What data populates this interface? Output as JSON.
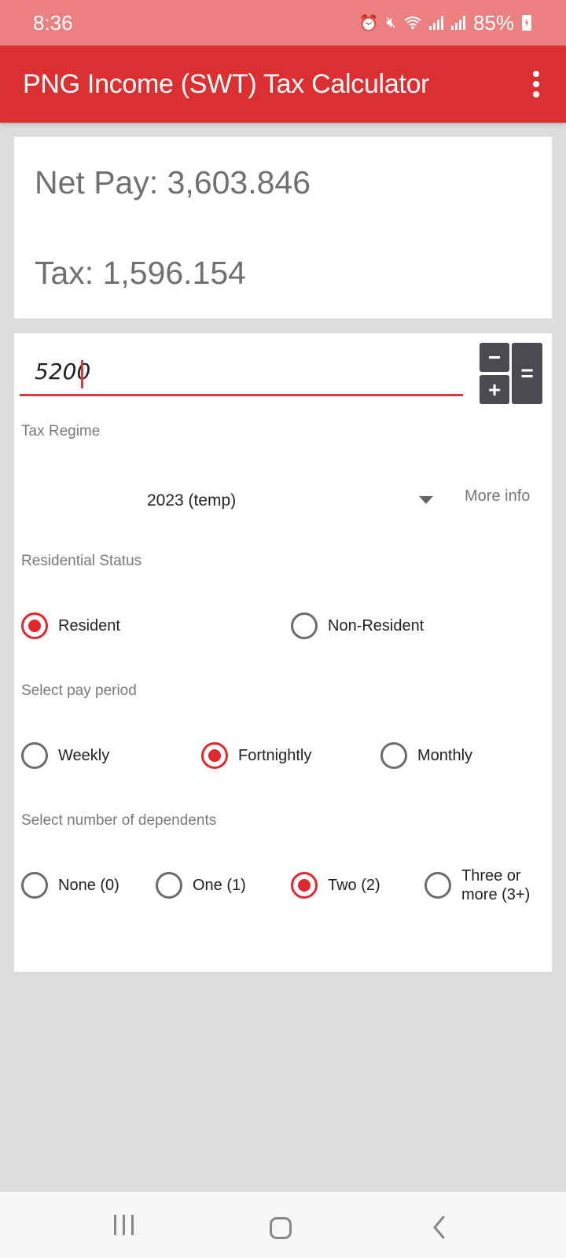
{
  "status_bar": {
    "time": "8:36",
    "battery": "85%",
    "icons": [
      "alarm-icon",
      "mute-icon",
      "wifi-icon",
      "signal-icon",
      "signal-icon",
      "battery-charging-icon"
    ]
  },
  "app_bar": {
    "title": "PNG Income (SWT) Tax Calculator",
    "menu_icon": "overflow-menu-icon"
  },
  "results": {
    "net_pay": "Net Pay: 3,603.846",
    "tax": "Tax: 1,596.154"
  },
  "form": {
    "amount_value": "5200",
    "calc_buttons": {
      "minus": "−",
      "plus": "+",
      "equals": "="
    },
    "tax_regime": {
      "label": "Tax Regime",
      "selected": "2023 (temp)",
      "more_info": "More info"
    },
    "residential_status": {
      "label": "Residential Status",
      "options": [
        {
          "label": "Resident",
          "checked": true
        },
        {
          "label": "Non-Resident",
          "checked": false
        }
      ]
    },
    "pay_period": {
      "label": "Select pay period",
      "options": [
        {
          "label": "Weekly",
          "checked": false
        },
        {
          "label": "Fortnightly",
          "checked": true
        },
        {
          "label": "Monthly",
          "checked": false
        }
      ]
    },
    "dependents": {
      "label": "Select number of dependents",
      "options": [
        {
          "label": "None (0)",
          "checked": false
        },
        {
          "label": "One (1)",
          "checked": false
        },
        {
          "label": "Two (2)",
          "checked": true
        },
        {
          "label": "Three or more (3+)",
          "checked": false
        }
      ]
    }
  },
  "colors": {
    "accent": "#dc2f31",
    "status_bar": "#ec8080",
    "radio_checked": "#e2282c",
    "button_dark": "#4a4a50"
  }
}
